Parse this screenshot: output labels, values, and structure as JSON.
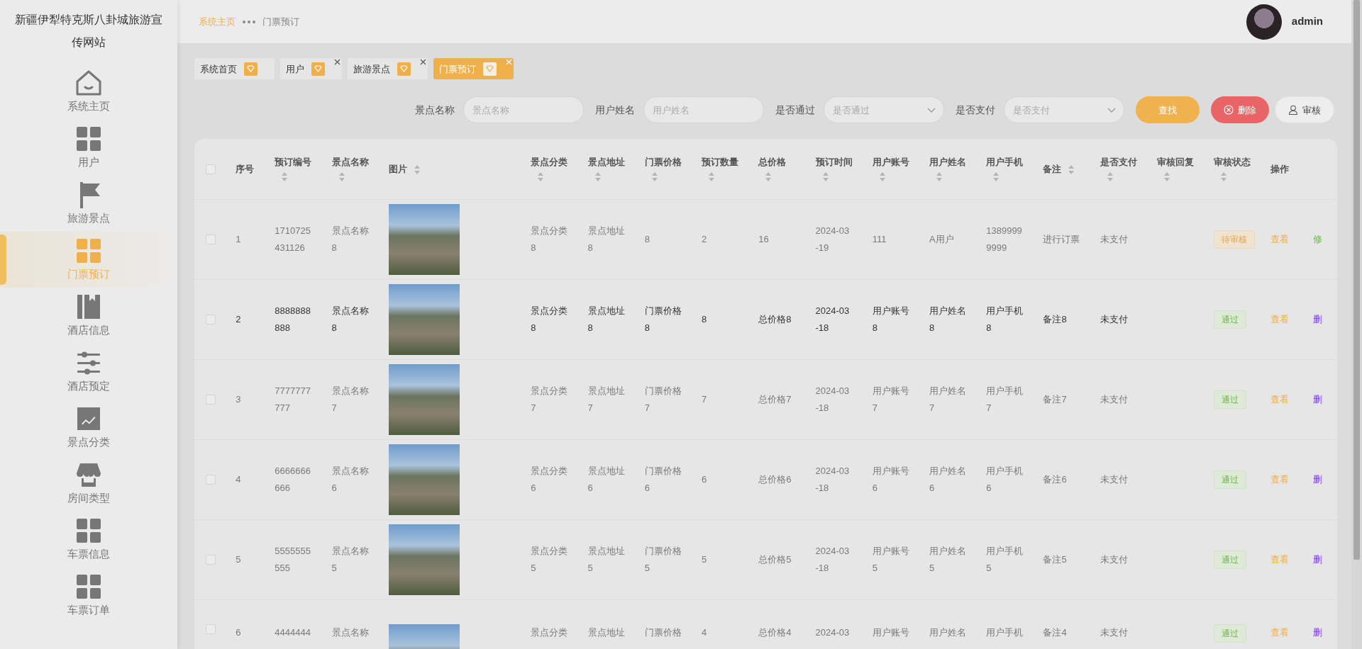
{
  "sidebar": {
    "title": "新疆伊犁特克斯八卦城旅游宣传网站",
    "items": [
      {
        "label": "系统主页",
        "kind": "home",
        "selected": false
      },
      {
        "label": "用户",
        "kind": "grid",
        "selected": false
      },
      {
        "label": "旅游景点",
        "kind": "flag",
        "selected": false
      },
      {
        "label": "门票预订",
        "kind": "grid",
        "selected": true
      },
      {
        "label": "酒店信息",
        "kind": "book",
        "selected": false
      },
      {
        "label": "酒店预定",
        "kind": "sliders",
        "selected": false
      },
      {
        "label": "景点分类",
        "kind": "chart",
        "selected": false
      },
      {
        "label": "房间类型",
        "kind": "store",
        "selected": false
      },
      {
        "label": "车票信息",
        "kind": "grid",
        "selected": false
      },
      {
        "label": "车票订单",
        "kind": "grid",
        "selected": false
      }
    ]
  },
  "header": {
    "breadcrumb": [
      {
        "label": "系统主页",
        "selected": true
      },
      {
        "label": "门票预订",
        "selected": false
      }
    ],
    "user": "admin"
  },
  "tabs": [
    {
      "label": "系统首页",
      "selected": false,
      "closable": false
    },
    {
      "label": "用户",
      "selected": false,
      "closable": true
    },
    {
      "label": "旅游景点",
      "selected": false,
      "closable": true
    },
    {
      "label": "门票预订",
      "selected": true,
      "closable": true
    }
  ],
  "search": {
    "fields": [
      {
        "label": "景点名称",
        "placeholder": "景点名称",
        "kind": "text"
      },
      {
        "label": "用户姓名",
        "placeholder": "用户姓名",
        "kind": "text"
      },
      {
        "label": "是否通过",
        "placeholder": "是否通过",
        "kind": "select"
      },
      {
        "label": "是否支付",
        "placeholder": "是否支付",
        "kind": "select"
      }
    ],
    "buttons": [
      {
        "label": "查找",
        "kind": "primary"
      },
      {
        "label": "删除",
        "kind": "danger"
      },
      {
        "label": "审核",
        "kind": "plain"
      }
    ]
  },
  "table": {
    "all_checked": false,
    "columns": [
      {
        "label": "序号",
        "sortable": false,
        "kind": "text"
      },
      {
        "label": "预订编号",
        "sortable": true,
        "kind": "text"
      },
      {
        "label": "景点名称",
        "sortable": true,
        "kind": "text"
      },
      {
        "label": "图片",
        "sortable": true,
        "kind": "image"
      },
      {
        "label": "景点分类",
        "sortable": true,
        "kind": "text"
      },
      {
        "label": "景点地址",
        "sortable": true,
        "kind": "text"
      },
      {
        "label": "门票价格",
        "sortable": true,
        "kind": "text"
      },
      {
        "label": "预订数量",
        "sortable": true,
        "kind": "text"
      },
      {
        "label": "总价格",
        "sortable": true,
        "kind": "text"
      },
      {
        "label": "预订时间",
        "sortable": true,
        "kind": "date"
      },
      {
        "label": "用户账号",
        "sortable": true,
        "kind": "text"
      },
      {
        "label": "用户姓名",
        "sortable": true,
        "kind": "text"
      },
      {
        "label": "用户手机",
        "sortable": true,
        "kind": "text"
      },
      {
        "label": "备注",
        "sortable": true,
        "kind": "text"
      },
      {
        "label": "是否支付",
        "sortable": true,
        "kind": "text"
      },
      {
        "label": "审核回复",
        "sortable": true,
        "kind": "text"
      },
      {
        "label": "审核状态",
        "sortable": true,
        "kind": "status"
      },
      {
        "label": "操作",
        "sortable": false,
        "kind": "actions"
      }
    ],
    "rows": [
      {
        "checked": false,
        "hovered": false,
        "cells": [
          "1",
          "1710725431126",
          "景点名称8",
          null,
          "景点分类8",
          "景点地址8",
          "8",
          "2",
          "16",
          "2024-03-19",
          "111",
          "A用户",
          "13899999999",
          "进行订票",
          "未支付",
          null
        ],
        "status": {
          "text": "待审核",
          "kind": "pending"
        },
        "actions": [
          {
            "label": "查看",
            "kind": "view"
          },
          {
            "label": "修",
            "kind": "edit"
          }
        ]
      },
      {
        "checked": false,
        "hovered": true,
        "cells": [
          "2",
          "8888888888",
          "景点名称8",
          null,
          "景点分类8",
          "景点地址8",
          "门票价格8",
          "8",
          "总价格8",
          "2024-03-18",
          "用户账号8",
          "用户姓名8",
          "用户手机8",
          "备注8",
          "未支付",
          null
        ],
        "status": {
          "text": "通过",
          "kind": "passed"
        },
        "actions": [
          {
            "label": "查看",
            "kind": "view"
          },
          {
            "label": "删",
            "kind": "delete"
          }
        ]
      },
      {
        "checked": false,
        "hovered": false,
        "cells": [
          "3",
          "7777777777",
          "景点名称7",
          null,
          "景点分类7",
          "景点地址7",
          "门票价格7",
          "7",
          "总价格7",
          "2024-03-18",
          "用户账号7",
          "用户姓名7",
          "用户手机7",
          "备注7",
          "未支付",
          null
        ],
        "status": {
          "text": "通过",
          "kind": "passed"
        },
        "actions": [
          {
            "label": "查看",
            "kind": "view"
          },
          {
            "label": "删",
            "kind": "delete"
          }
        ]
      },
      {
        "checked": false,
        "hovered": false,
        "cells": [
          "4",
          "6666666666",
          "景点名称6",
          null,
          "景点分类6",
          "景点地址6",
          "门票价格6",
          "6",
          "总价格6",
          "2024-03-18",
          "用户账号6",
          "用户姓名6",
          "用户手机6",
          "备注6",
          "未支付",
          null
        ],
        "status": {
          "text": "通过",
          "kind": "passed"
        },
        "actions": [
          {
            "label": "查看",
            "kind": "view"
          },
          {
            "label": "删",
            "kind": "delete"
          }
        ]
      },
      {
        "checked": false,
        "hovered": false,
        "cells": [
          "5",
          "5555555555",
          "景点名称5",
          null,
          "景点分类5",
          "景点地址5",
          "门票价格5",
          "5",
          "总价格5",
          "2024-03-18",
          "用户账号5",
          "用户姓名5",
          "用户手机5",
          "备注5",
          "未支付",
          null
        ],
        "status": {
          "text": "通过",
          "kind": "passed"
        },
        "actions": [
          {
            "label": "查看",
            "kind": "view"
          },
          {
            "label": "删",
            "kind": "delete"
          }
        ]
      },
      {
        "checked": false,
        "hovered": false,
        "cells": [
          "6",
          "4444444",
          "景点名称",
          null,
          "景点分类",
          "景点地址",
          "门票价格",
          "4",
          "总价格4",
          "2024-03",
          "用户账号",
          "用户姓名",
          "用户手机",
          "备注4",
          "未支付",
          null
        ],
        "status": {
          "text": "通过",
          "kind": "passed"
        },
        "actions": [
          {
            "label": "查看",
            "kind": "view"
          },
          {
            "label": "删",
            "kind": "delete"
          }
        ]
      }
    ]
  }
}
